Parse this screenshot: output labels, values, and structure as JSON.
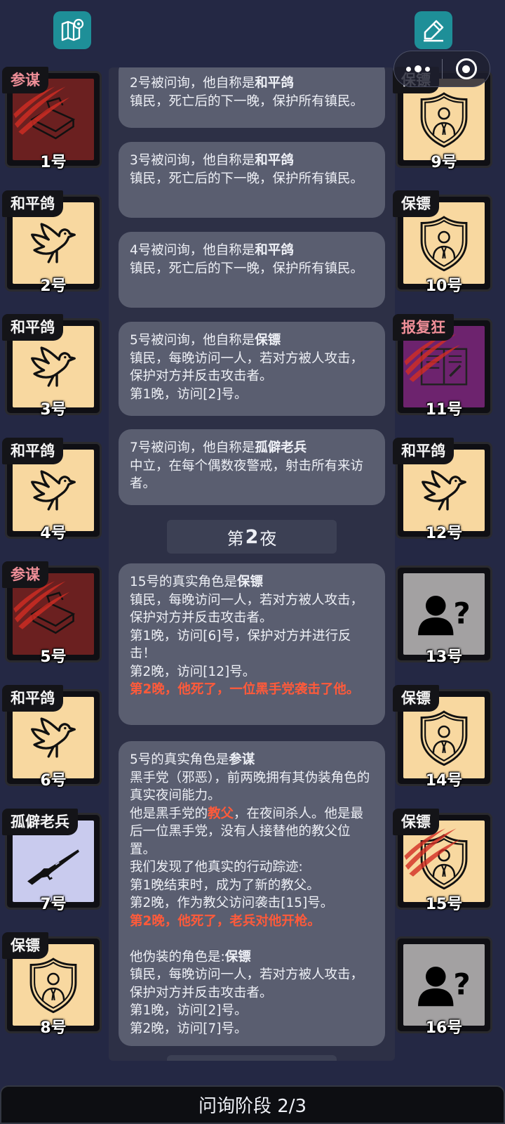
{
  "toolbar": {
    "map_icon": "map-pin-icon",
    "note_icon": "edit-note-icon"
  },
  "players": [
    {
      "num": "1号",
      "role": "参谋",
      "art": "briefcase",
      "status": "dead",
      "evil": true
    },
    {
      "num": "2号",
      "role": "和平鸽",
      "art": "dove",
      "status": "alive",
      "evil": false
    },
    {
      "num": "3号",
      "role": "和平鸽",
      "art": "dove",
      "status": "alive",
      "evil": false
    },
    {
      "num": "4号",
      "role": "和平鸽",
      "art": "dove",
      "status": "alive",
      "evil": false
    },
    {
      "num": "5号",
      "role": "参谋",
      "art": "briefcase",
      "status": "dead",
      "evil": true
    },
    {
      "num": "6号",
      "role": "和平鸽",
      "art": "dove",
      "status": "alive",
      "evil": false
    },
    {
      "num": "7号",
      "role": "孤僻老兵",
      "art": "rifle",
      "status": "alive",
      "evil": false
    },
    {
      "num": "8号",
      "role": "保镖",
      "art": "bodyguard",
      "status": "alive",
      "evil": false
    },
    {
      "num": "9号",
      "role": "保镖",
      "art": "bodyguard",
      "status": "alive",
      "evil": false
    },
    {
      "num": "10号",
      "role": "保镖",
      "art": "bodyguard",
      "status": "alive",
      "evil": false
    },
    {
      "num": "11号",
      "role": "报复狂",
      "art": "book",
      "status": "dead",
      "evil": true
    },
    {
      "num": "12号",
      "role": "和平鸽",
      "art": "dove",
      "status": "alive",
      "evil": false
    },
    {
      "num": "13号",
      "role": "",
      "art": "unknown",
      "status": "alive",
      "evil": false
    },
    {
      "num": "14号",
      "role": "保镖",
      "art": "bodyguard",
      "status": "alive",
      "evil": false
    },
    {
      "num": "15号",
      "role": "保镖",
      "art": "bodyguard",
      "status": "dead",
      "evil": false
    },
    {
      "num": "16号",
      "role": "",
      "art": "unknown",
      "status": "alive",
      "evil": false
    }
  ],
  "log": {
    "m1": {
      "a": "2号被问询，他自称是",
      "b": "和平鸽",
      "c": "镇民，死亡后的下一晚，保护所有镇民。"
    },
    "m2": {
      "a": "3号被问询，他自称是",
      "b": "和平鸽",
      "c": "镇民，死亡后的下一晚，保护所有镇民。"
    },
    "m3": {
      "a": "4号被问询，他自称是",
      "b": "和平鸽",
      "c": "镇民，死亡后的下一晚，保护所有镇民。"
    },
    "m4": {
      "a": "5号被问询，他自称是",
      "b": "保镖",
      "c": "镇民，每晚访问一人，若对方被人攻击，保护对方并反击攻击者。",
      "d": "第1晚，访问[2]号。"
    },
    "m5": {
      "a": "7号被问询，他自称是",
      "b": "孤僻老兵",
      "c": "中立，在每个偶数夜警戒，射击所有来访者。"
    },
    "night": {
      "pre": "第",
      "n": "2",
      "post": "夜"
    },
    "m6": {
      "a": "15号的真实角色是",
      "b": "保镖",
      "c": "镇民，每晚访问一人，若对方被人攻击，保护对方并反击攻击者。",
      "d": "第1晚，访问[6]号，保护对方并进行反击！",
      "e": "第2晚，访问[12]号。",
      "f": "第2晚，他死了，一位黑手党袭击了他。"
    },
    "m7": {
      "a": "5号的真实角色是",
      "b": "参谋",
      "c": "黑手党（邪恶），前两晚拥有其伪装角色的真实夜间能力。",
      "d1": "他是黑手党的",
      "d2": "教父",
      "d3": "，在夜间杀人。他是最后一位黑手党，没有人接替他的教父位置。",
      "e": "我们发现了他真实的行动踪迹:",
      "f": "第1晚结束时，成为了新的教父。",
      "g": "第2晚，作为教父访问袭击[15]号。",
      "h": "第2晚，他死了，老兵对他开枪。",
      "i": "他伪装的角色是:",
      "j": "保镖",
      "k": "镇民，每晚访问一人，若对方被人攻击，保护对方并反击攻击者。",
      "l": "第1晚，访问[2]号。",
      "m": "第2晚，访问[7]号。"
    }
  },
  "phase": {
    "label": "问询阶段 2/3"
  },
  "colors": {
    "background": "#242844",
    "card": "#f8d8a0",
    "accent": "#1e8f98",
    "death_text": "#ff5a3a",
    "evil_tag": "#f08f98"
  }
}
